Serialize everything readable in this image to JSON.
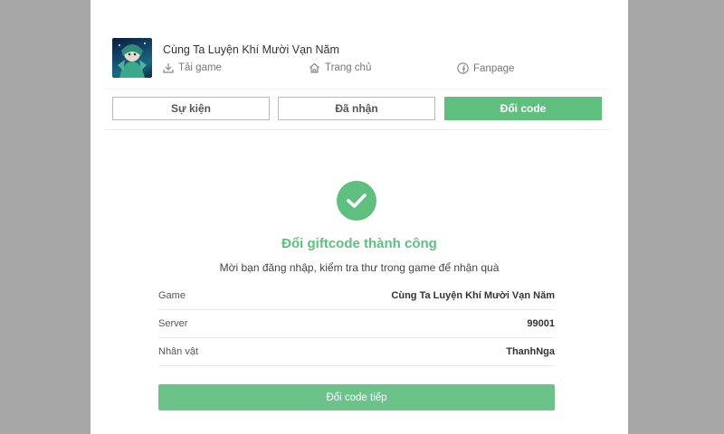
{
  "header": {
    "game_title": "Cùng Ta Luyện Khí Mười Vạn Năm",
    "links": [
      {
        "label": "Tải game",
        "icon": "download-icon"
      },
      {
        "label": "Trang chủ",
        "icon": "home-icon"
      },
      {
        "label": "Fanpage",
        "icon": "facebook-icon"
      }
    ]
  },
  "tabs": [
    {
      "label": "Sự kiện",
      "active": false
    },
    {
      "label": "Đã nhận",
      "active": false
    },
    {
      "label": "Đổi code",
      "active": true
    }
  ],
  "result": {
    "icon": "checkmark-icon",
    "title": "Đổi giftcode thành công",
    "message": "Mời bạn đăng nhập, kiểm tra thư trong game để nhận quà"
  },
  "details": [
    {
      "label": "Game",
      "value": "Cùng Ta Luyện Khí Mười Vạn Năm"
    },
    {
      "label": "Server",
      "value": "99001"
    },
    {
      "label": "Nhân vật",
      "value": "ThanhNga"
    }
  ],
  "continue_button": "Đổi code tiếp",
  "colors": {
    "accent": "#5fbf7e",
    "background": "#a7a7a7",
    "panel": "#ffffff"
  }
}
